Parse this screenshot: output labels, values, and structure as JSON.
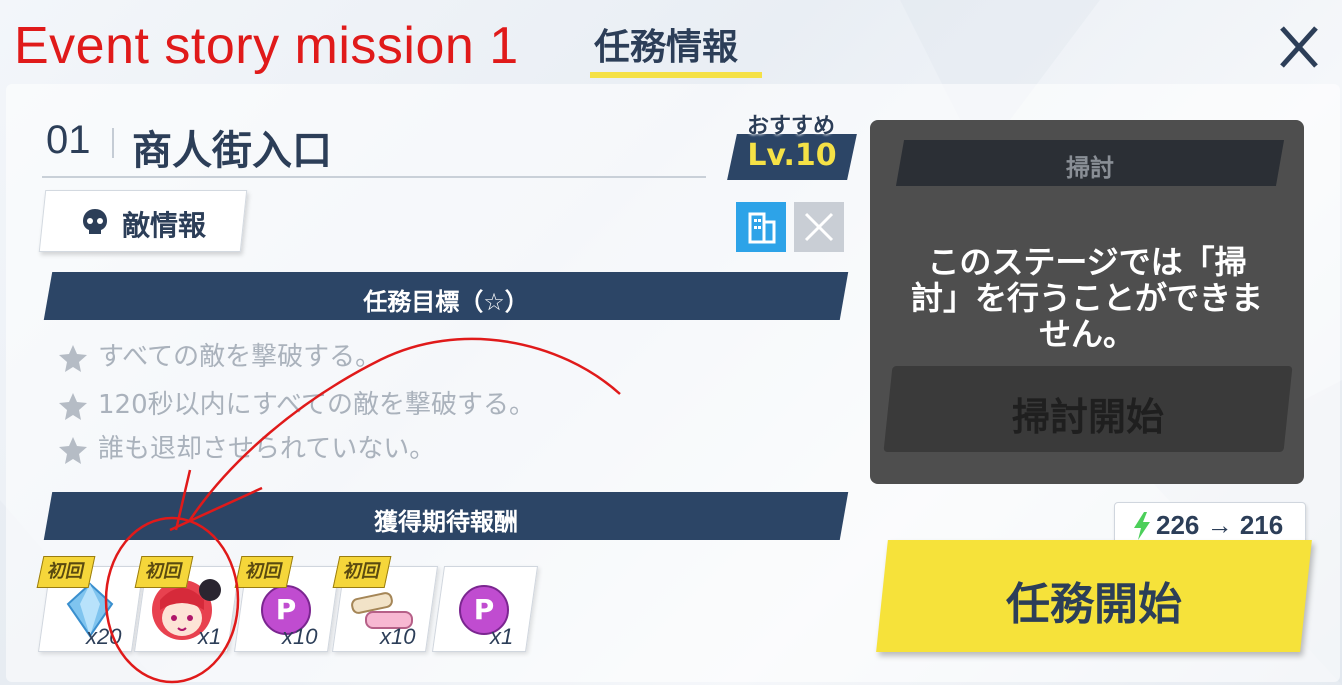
{
  "annotation": {
    "title": "Event story mission 1"
  },
  "header": {
    "title": "任務情報"
  },
  "stage": {
    "number": "01",
    "name": "商人街入口"
  },
  "recommend": {
    "label": "おすすめ",
    "level": "Lv.10"
  },
  "enemy_info": {
    "label": "敵情報"
  },
  "objectives": {
    "title": "任務目標（☆）",
    "items": [
      "すべての敵を撃破する。",
      "120秒以内にすべての敵を撃破する。",
      "誰も退却させられていない。"
    ]
  },
  "rewards": {
    "title": "獲得期待報酬",
    "first_label": "初回",
    "items": [
      {
        "icon": "crystal-icon",
        "count": "x20",
        "first": true
      },
      {
        "icon": "character-portrait-icon",
        "count": "x1",
        "first": true
      },
      {
        "icon": "p-coin-icon",
        "count": "x10",
        "first": true
      },
      {
        "icon": "material-scroll-icon",
        "count": "x10",
        "first": true
      },
      {
        "icon": "p-coin-icon",
        "count": "x1",
        "first": false
      }
    ]
  },
  "sweep": {
    "title": "掃討",
    "message": "このステージでは「掃討」を行うことができません。",
    "button": "掃討開始"
  },
  "ap": {
    "text": "226 → 216"
  },
  "start": {
    "label": "任務開始"
  },
  "colors": {
    "navy": "#2c4566",
    "yellow": "#f6e23a",
    "annotation_red": "#e01a1a"
  }
}
